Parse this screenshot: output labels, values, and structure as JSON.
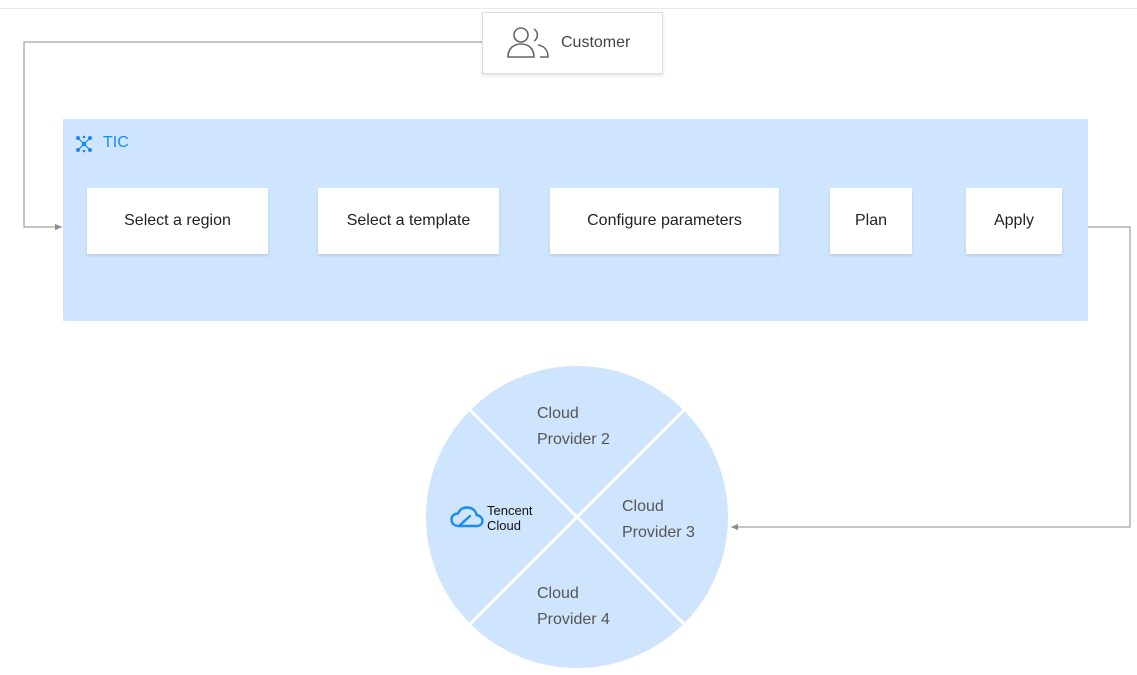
{
  "customer": {
    "label": "Customer",
    "icon": "users-icon"
  },
  "tic": {
    "label": "TIC",
    "icon": "tic-logo-icon",
    "accent_color": "#1a8bf0",
    "panel_color": "#cfe4fd"
  },
  "steps": [
    {
      "label": "Select a region"
    },
    {
      "label": "Select a template"
    },
    {
      "label": "Configure parameters"
    },
    {
      "label": "Plan"
    },
    {
      "label": "Apply"
    }
  ],
  "providers": {
    "tencent": {
      "line1": "Tencent",
      "line2": "Cloud",
      "icon": "tencent-cloud-logo-icon"
    },
    "provider_2": {
      "line1": "Cloud",
      "line2": "Provider 2"
    },
    "provider_3": {
      "line1": "Cloud",
      "line2": "Provider 3"
    },
    "provider_4": {
      "line1": "Cloud",
      "line2": "Provider 4"
    },
    "wheel_color": "#cfe4fd"
  },
  "colors": {
    "connector": "#8c8c8c",
    "step_background": "#ffffff"
  }
}
